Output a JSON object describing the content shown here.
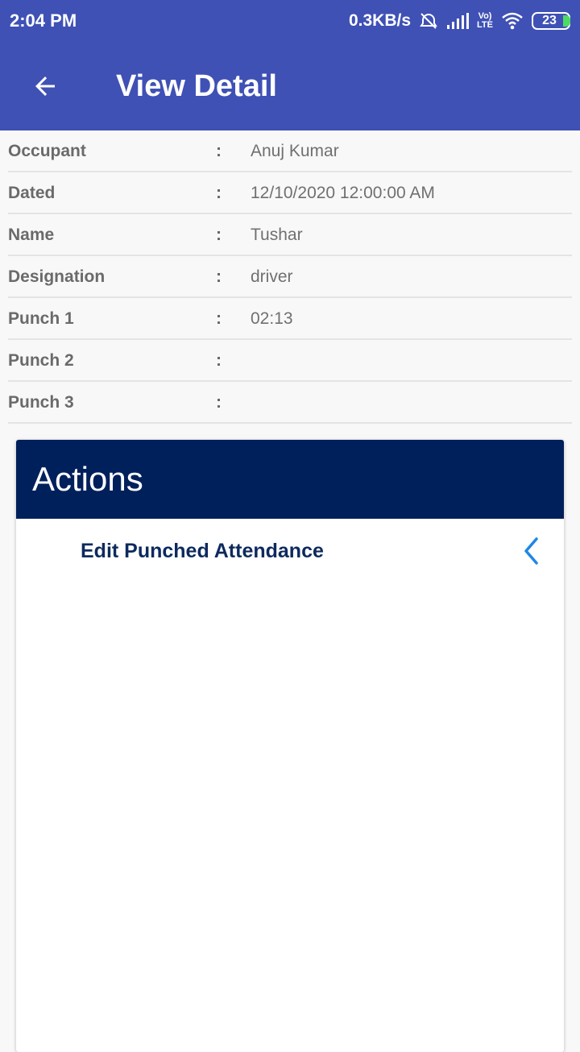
{
  "status_bar": {
    "time": "2:04 PM",
    "speed": "0.3KB/s",
    "lte_top": "Vo)",
    "lte_bottom": "LTE",
    "battery": "23"
  },
  "app_bar": {
    "title": "View Detail",
    "back_icon": "arrow-back-icon"
  },
  "details": {
    "separator": ":",
    "rows": [
      {
        "label": "Occupant",
        "value": "Anuj Kumar"
      },
      {
        "label": "Dated",
        "value": "12/10/2020 12:00:00 AM"
      },
      {
        "label": "Name",
        "value": "Tushar"
      },
      {
        "label": "Designation",
        "value": "driver"
      },
      {
        "label": "Punch 1",
        "value": "02:13"
      },
      {
        "label": "Punch 2",
        "value": ""
      },
      {
        "label": "Punch 3",
        "value": ""
      }
    ]
  },
  "actions": {
    "title": "Actions",
    "items": [
      {
        "label": "Edit Punched Attendance",
        "icon": "chevron-left-icon"
      }
    ]
  },
  "colors": {
    "primary": "#3f51b5",
    "actions_header": "#00205b",
    "action_text": "#0d2a5e",
    "chevron": "#1e88e5"
  }
}
